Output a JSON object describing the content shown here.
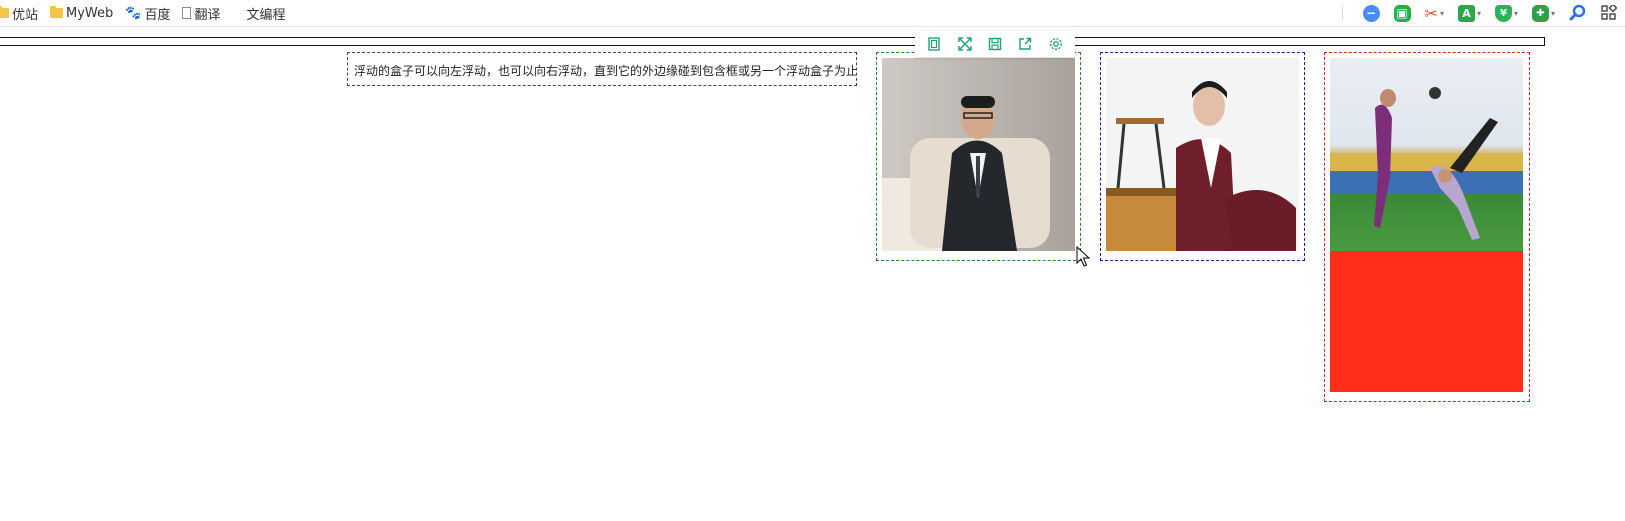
{
  "bookmarks": [
    {
      "label": "优站",
      "icon": "folder-icon"
    },
    {
      "label": "MyWeb",
      "icon": "folder-icon"
    },
    {
      "label": "百度",
      "icon": "baidu-paw-icon"
    },
    {
      "label": "翻译",
      "icon": "page-icon"
    },
    {
      "label": "文编程",
      "icon": "bars-logo-icon"
    }
  ],
  "extensions": [
    {
      "name": "minus-circle-icon",
      "color": "#4a8cf7"
    },
    {
      "name": "green-ext-icon",
      "color": "#21b34a"
    },
    {
      "name": "scissors-icon",
      "color": "#f04a3a"
    },
    {
      "name": "translate-icon",
      "color": "#29a84b"
    },
    {
      "name": "shield-yen-icon",
      "color": "#2fb15a"
    },
    {
      "name": "gamepad-icon",
      "color": "#2fa14a"
    },
    {
      "name": "search-icon",
      "color": "#2d6fe0"
    },
    {
      "name": "apps-grid-icon",
      "color": "#444444"
    }
  ],
  "content": {
    "float_text": "浮动的盒子可以向左浮动，也可以向右浮动，直到它的外边缘碰到包含框或另一个浮动盒子为止。"
  },
  "image_toolbar": {
    "buttons": [
      "fit-icon",
      "fullscreen-icon",
      "save-icon",
      "share-icon",
      "settings-icon"
    ]
  },
  "colors": {
    "box1_border": "#2e7d32",
    "box2_border": "#1a237e",
    "box3_border": "#c62828",
    "red_block": "#ff2d1a"
  }
}
